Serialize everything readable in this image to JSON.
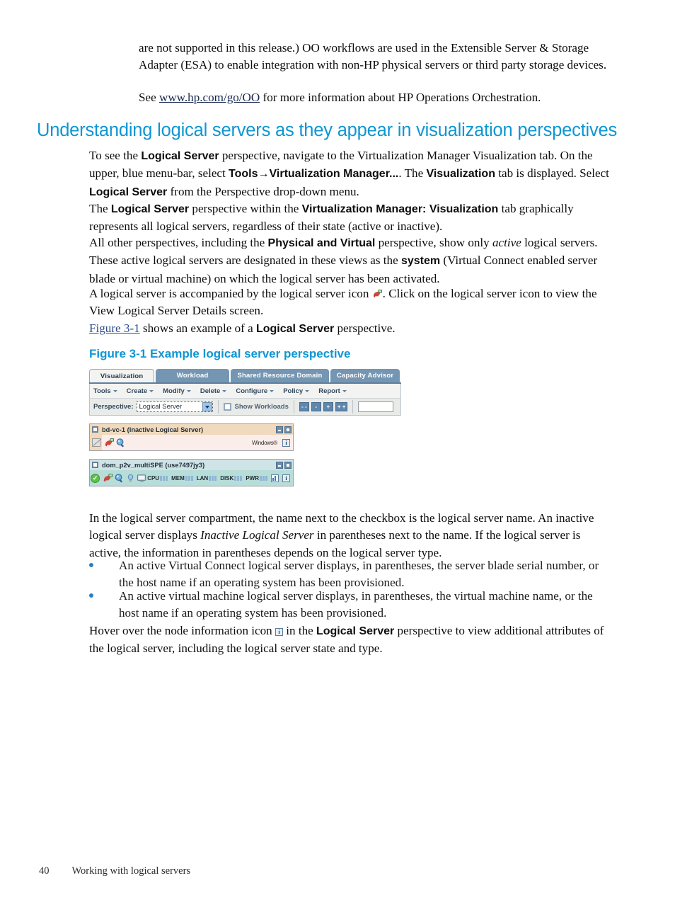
{
  "top_paragraphs": [
    "are not supported in this release.) OO workflows are used in the Extensible Server & Storage Adapter (ESA) to enable integration with non-HP physical servers or third party storage devices."
  ],
  "see_line": {
    "prefix": "See ",
    "link": "www.hp.com/go/OO",
    "suffix": " for more information about HP Operations Orchestration."
  },
  "section_heading": "Understanding logical servers as they appear in visualization perspectives",
  "paragraph_1": {
    "s1": "To see the ",
    "b1": "Logical Server",
    "s2": " perspective, navigate to the Virtualization Manager Visualization tab. On the upper, blue menu-bar, select ",
    "b2": "Tools→Virtualization Manager...",
    "s3": ". The ",
    "b3": "Visualization",
    "s4": " tab is displayed. Select ",
    "b4": "Logical Server",
    "s5": " from the Perspective drop-down menu."
  },
  "paragraph_2": {
    "s1": "The ",
    "b1": "Logical Server",
    "s2": " perspective within the ",
    "b2": "Virtualization Manager: Visualization",
    "s3": " tab graphically represents all logical servers, regardless of their state (active or inactive)."
  },
  "paragraph_3": {
    "s1": "All other perspectives, including the ",
    "b1": "Physical and Virtual",
    "s2": " perspective, show only ",
    "i1": "active",
    "s3": " logical servers. These active logical servers are designated in these views as the ",
    "b2": "system",
    "s4": " (Virtual Connect enabled server blade or virtual machine) on which the logical server has been activated."
  },
  "paragraph_4": {
    "s1": "A logical server is accompanied by the logical server icon ",
    "s2": ". Click on the logical server icon to view the View Logical Server Details screen."
  },
  "paragraph_5": {
    "ref": "Figure 3-1",
    "s1": " shows an example of a ",
    "b1": "Logical Server",
    "s2": " perspective."
  },
  "figure": {
    "caption": "Figure 3-1 Example logical server perspective",
    "tabs": [
      {
        "label": "Visualization",
        "active": true
      },
      {
        "label": "Workload",
        "active": false
      },
      {
        "label": "Shared Resource Domain",
        "active": false
      },
      {
        "label": "Capacity Advisor",
        "active": false
      }
    ],
    "menu_items": [
      "Tools",
      "Create",
      "Modify",
      "Delete",
      "Configure",
      "Policy",
      "Report"
    ],
    "controls": {
      "perspective_label": "Perspective:",
      "perspective_value": "Logical Server",
      "show_workloads_label": "Show Workloads",
      "zoom_buttons": [
        "- -",
        "-",
        "+",
        "+ +"
      ]
    },
    "compartments": [
      {
        "name": "bd-vc-1 (Inactive Logical Server)",
        "state": "inactive",
        "header_bg": "#f0d9bd",
        "body_bg": "#fbeeea",
        "icons": [
          "logical-server-icon",
          "magnifier-icon"
        ],
        "os_label": "Windows®",
        "metrics": [],
        "has_chart_icon": false,
        "has_info_icon": true
      },
      {
        "name": "dom_p2v_multiSPE (use7497jy3)",
        "state": "active",
        "header_bg": "#cfe4e6",
        "body_bg": "#b7ddd9",
        "icons": [
          "logical-server-icon",
          "magnifier-icon",
          "bulb-icon",
          "monitor-icon"
        ],
        "os_label": "",
        "metrics": [
          "CPU",
          "MEM",
          "LAN",
          "DISK",
          "PWR"
        ],
        "has_chart_icon": true,
        "has_info_icon": true
      }
    ]
  },
  "paragraph_6": {
    "s1": "In the logical server compartment, the name next to the checkbox is the logical server name. An inactive logical server displays ",
    "i1": "Inactive Logical Server",
    "s2": " in parentheses next to the name. If the logical server is active, the information in parentheses depends on the logical server type."
  },
  "bullets": [
    "An active Virtual Connect logical server displays, in parentheses, the server blade serial number, or the host name if an operating system has been provisioned.",
    "An active virtual machine logical server displays, in parentheses, the virtual machine name, or the host name if an operating system has been provisioned."
  ],
  "paragraph_7": {
    "s1": "Hover over the node information icon ",
    "s2": " in the ",
    "b1": "Logical Server",
    "s3": " perspective to view additional attributes of the logical server, including the logical server state and type."
  },
  "footer": {
    "page_number": "40",
    "section": "Working with logical servers"
  },
  "colors": {
    "heading": "#0e96d3",
    "link": "#16264f",
    "figref": "#2b4d8c",
    "tab_inactive": "#7596b3",
    "bullet": "#2f7fbf"
  }
}
